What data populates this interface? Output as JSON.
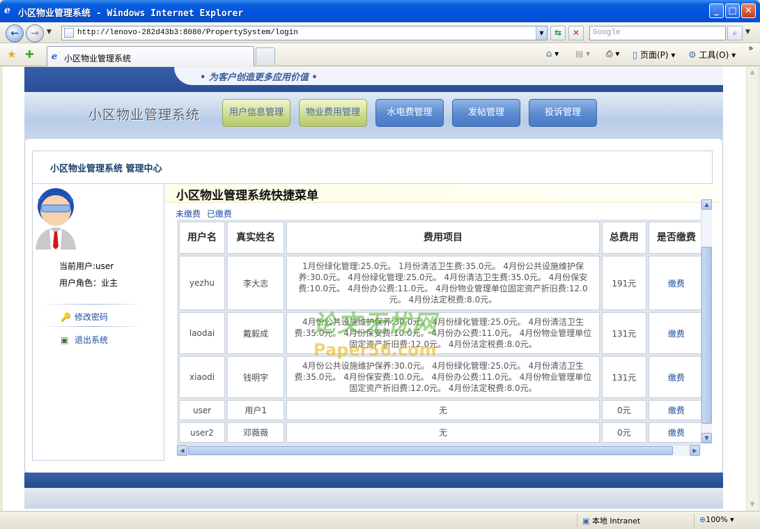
{
  "window": {
    "title": "小区物业管理系统 - Windows Internet Explorer"
  },
  "address": {
    "url": "http://lenovo-282d43b3:8080/PropertySystem/login",
    "search_placeholder": "Google"
  },
  "tab": {
    "label": "小区物业管理系统"
  },
  "commands": {
    "page": "页面(P)",
    "tools": "工具(O)"
  },
  "site": {
    "slogan": "• 为客户创造更多应用价值 •",
    "title": "小区物业管理系统",
    "nav": [
      "用户信息管理",
      "物业费用管理",
      "水电费管理",
      "发帖管理",
      "投诉管理"
    ]
  },
  "panel": {
    "header": "小区物业管理系统  管理中心",
    "current_user": "当前用户:user",
    "user_role": "用户角色：业主",
    "change_password": "修改密码",
    "logout": "退出系统"
  },
  "menu": {
    "title": "小区物业管理系统快捷菜单",
    "filter_unpaid": "未缴费",
    "filter_paid": "已缴费"
  },
  "table": {
    "headers": {
      "username": "用户名",
      "realname": "真实姓名",
      "items": "费用项目",
      "total": "总费用",
      "paid": "是否缴费"
    },
    "rows": [
      {
        "username": "yezhu",
        "realname": "李大志",
        "items": "1月份绿化管理:25.0元。 1月份清洁卫生费:35.0元。 4月份公共设施维护保养:30.0元。 4月份绿化管理:25.0元。 4月份清洁卫生费:35.0元。 4月份保安费:10.0元。 4月份办公费:11.0元。 4月份物业管理单位固定资产折旧费:12.0元。 4月份法定税费:8.0元。",
        "total": "191元",
        "action": "缴费"
      },
      {
        "username": "laodai",
        "realname": "戴毅成",
        "items": "4月份公共设施维护保养:30.0元。 4月份绿化管理:25.0元。 4月份清洁卫生费:35.0元。 4月份保安费:10.0元。 4月份办公费:11.0元。 4月份物业管理单位固定资产折旧费:12.0元。 4月份法定税费:8.0元。",
        "total": "131元",
        "action": "缴费"
      },
      {
        "username": "xiaodi",
        "realname": "钱明宇",
        "items": "4月份公共设施维护保养:30.0元。 4月份绿化管理:25.0元。 4月份清洁卫生费:35.0元。 4月份保安费:10.0元。 4月份办公费:11.0元。 4月份物业管理单位固定资产折旧费:12.0元。 4月份法定税费:8.0元。",
        "total": "131元",
        "action": "缴费"
      },
      {
        "username": "user",
        "realname": "用户1",
        "items": "无",
        "total": "0元",
        "action": "缴费"
      },
      {
        "username": "user2",
        "realname": "邓薇薇",
        "items": "无",
        "total": "0元",
        "action": "缴费"
      }
    ]
  },
  "watermark": {
    "line1": "论文无忧网",
    "line2": "Paper56.com"
  },
  "status": {
    "zone": "本地 Intranet",
    "zoom": "100%"
  }
}
